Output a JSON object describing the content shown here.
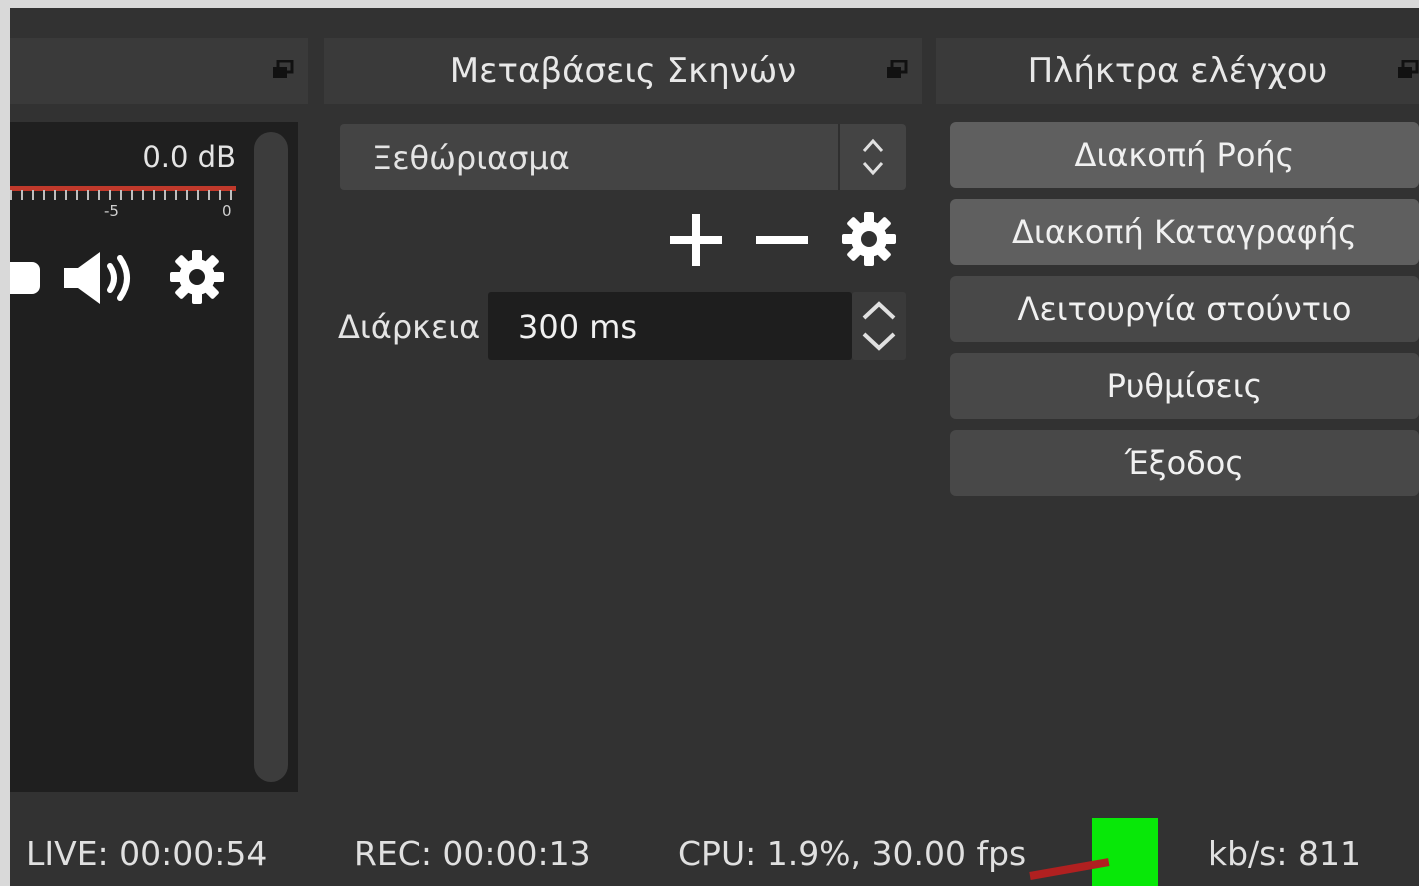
{
  "colors": {
    "background": "#323232",
    "dock_title_bg": "#3a3a3a",
    "meter_red": "#c0392b",
    "status_ok": "#08e808",
    "button_active": "#5f5f5f",
    "button": "#484848"
  },
  "mixer": {
    "db_value": "0.0 dB",
    "tick_minus5": "-5",
    "tick_zero": "0",
    "icons": [
      "speaker-icon",
      "gear-icon"
    ]
  },
  "transitions": {
    "title": "Μεταβάσεις Σκηνών",
    "selected_transition": "Ξεθώριασμα",
    "duration_label": "Διάρκεια",
    "duration_value": "300 ms",
    "icons": [
      "plus-icon",
      "minus-icon",
      "gear-icon"
    ]
  },
  "controls": {
    "title": "Πλήκτρα ελέγχου",
    "buttons": [
      {
        "label": "Διακοπή Ροής",
        "active": true
      },
      {
        "label": "Διακοπή Καταγραφής",
        "active": true
      },
      {
        "label": "Λειτουργία στούντιο",
        "active": false
      },
      {
        "label": "Ρυθμίσεις",
        "active": false
      },
      {
        "label": "Έξοδος",
        "active": false
      }
    ]
  },
  "status_bar": {
    "live": "LIVE: 00:00:54",
    "rec": "REC: 00:00:13",
    "cpu": "CPU: 1.9%, 30.00 fps",
    "bitrate": "kb/s: 811"
  }
}
